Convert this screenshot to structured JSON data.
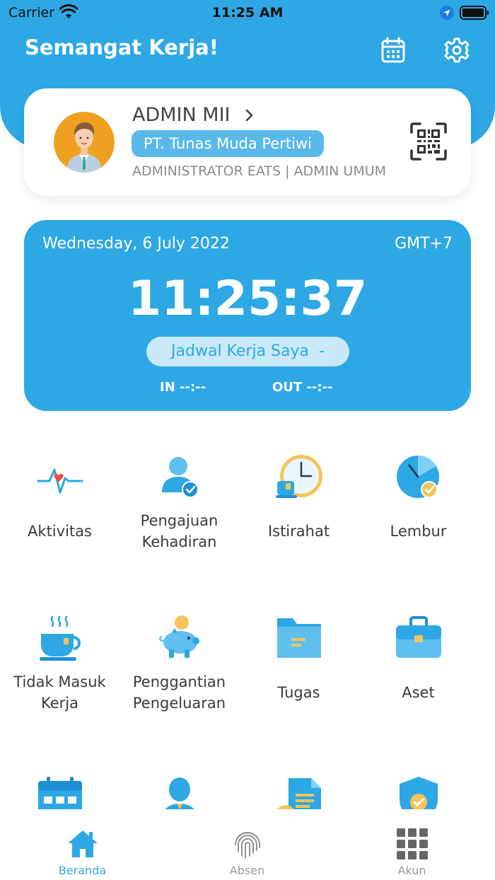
{
  "status_bar": {
    "carrier": "Carrier",
    "time": "11:25 AM"
  },
  "header": {
    "greeting": "Semangat Kerja!",
    "calendar_icon": "calendar-icon",
    "settings_icon": "gear-icon"
  },
  "profile": {
    "name": "ADMIN MII",
    "company": "PT. Tunas Muda Pertiwi",
    "role": "ADMINISTRATOR EATS | ADMIN UMUM",
    "qr_icon": "qr-code-icon"
  },
  "attendance": {
    "date": "Wednesday, 6 July 2022",
    "timezone": "GMT+7",
    "time": "11:25:37",
    "schedule_label": "Jadwal Kerja Saya  -",
    "in_label": "IN --:--",
    "out_label": "OUT --:--"
  },
  "menu": {
    "items": [
      {
        "label": "Aktivitas",
        "icon": "activity-heartbeat-icon"
      },
      {
        "label": "Pengajuan\nKehadiran",
        "icon": "attendance-request-icon"
      },
      {
        "label": "Istirahat",
        "icon": "break-clock-icon"
      },
      {
        "label": "Lembur",
        "icon": "overtime-icon"
      },
      {
        "label": "Tidak Masuk\nKerja",
        "icon": "coffee-cup-icon"
      },
      {
        "label": "Penggantian\nPengeluaran",
        "icon": "piggy-bank-icon"
      },
      {
        "label": "Tugas",
        "icon": "folder-icon"
      },
      {
        "label": "Aset",
        "icon": "briefcase-icon"
      },
      {
        "label": "",
        "icon": "calendar-grid-icon"
      },
      {
        "label": "",
        "icon": "person-icon"
      },
      {
        "label": "",
        "icon": "document-icon"
      },
      {
        "label": "",
        "icon": "shield-check-icon"
      }
    ]
  },
  "bottom_nav": {
    "items": [
      {
        "label": "Beranda",
        "icon": "home-icon",
        "active": true
      },
      {
        "label": "Absen",
        "icon": "fingerprint-icon",
        "active": false
      },
      {
        "label": "Akun",
        "icon": "grid-icon",
        "active": false
      }
    ]
  },
  "colors": {
    "primary": "#2DA8E4",
    "badge": "#5AB9E8",
    "avatar_bg": "#F0A020"
  }
}
